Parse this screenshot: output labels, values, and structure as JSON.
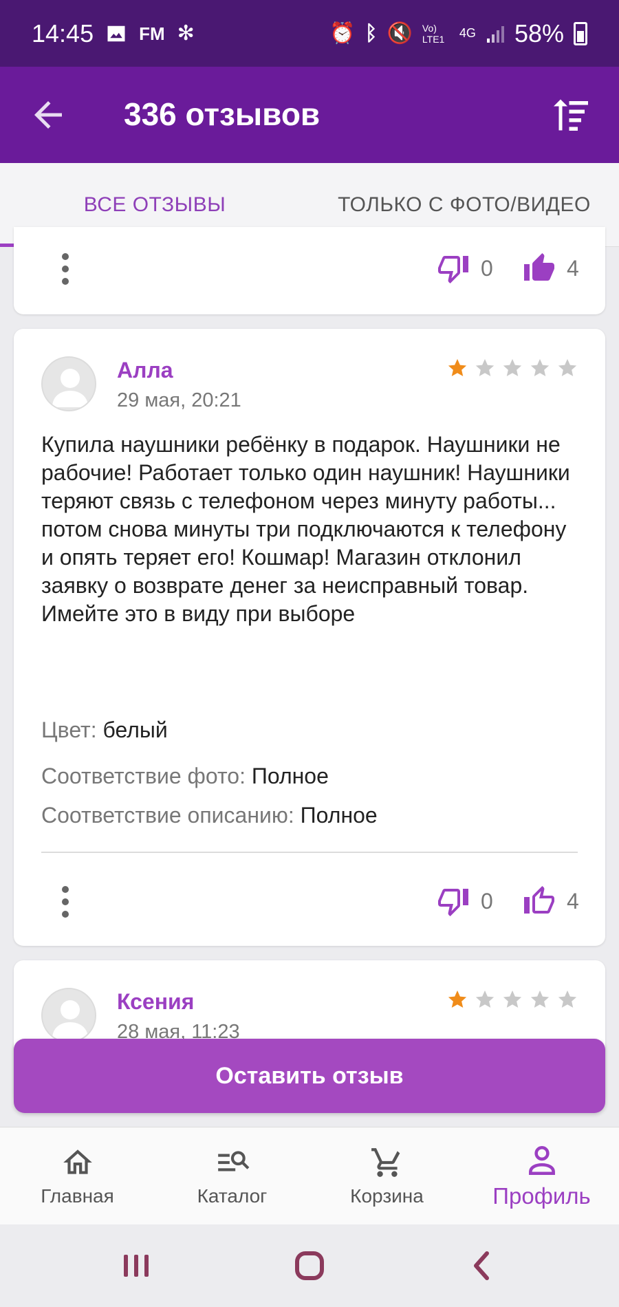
{
  "status": {
    "time": "14:45",
    "battery": "58%",
    "net": "4G",
    "volte": "Vo) LTE1"
  },
  "appbar": {
    "title": "336 отзывов"
  },
  "tabs": [
    {
      "label": "ВСЕ ОТЗЫВЫ",
      "active": true
    },
    {
      "label": "ТОЛЬКО С ФОТО/ВИДЕО",
      "active": false
    }
  ],
  "prev_card": {
    "dislikes": "0",
    "likes": "4"
  },
  "review": {
    "author": "Алла",
    "date": "29 мая, 20:21",
    "rating": 1,
    "text": "Купила наушники ребёнку в подарок. Наушники не рабочие! Работает только один наушник! Наушники теряют связь с телефоном через минуту работы... потом снова минуты три подключаются к телефону и опять теряет его! Кошмар! Магазин отклонил заявку о возврате денег за неисправный товар. Имейте это в виду при выборе",
    "props": [
      {
        "key": "Цвет:",
        "value": "белый"
      },
      {
        "key": "Соответствие фото:",
        "value": "Полное"
      },
      {
        "key": "Соответствие описанию:",
        "value": "Полное"
      }
    ],
    "dislikes": "0",
    "likes": "4"
  },
  "next_review": {
    "author": "Ксения",
    "date": "28 мая, 11:23",
    "rating": 1
  },
  "cta": {
    "label": "Оставить отзыв"
  },
  "nav": [
    {
      "label": "Главная",
      "icon": "home-icon"
    },
    {
      "label": "Каталог",
      "icon": "catalog-search-icon"
    },
    {
      "label": "Корзина",
      "icon": "cart-icon"
    },
    {
      "label": "Профиль",
      "icon": "profile-icon",
      "active": true
    }
  ],
  "colors": {
    "primary": "#6a1b9a",
    "accent": "#9b3fc2",
    "star_active": "#f08c1a",
    "star_inactive": "#c8c8c8"
  }
}
